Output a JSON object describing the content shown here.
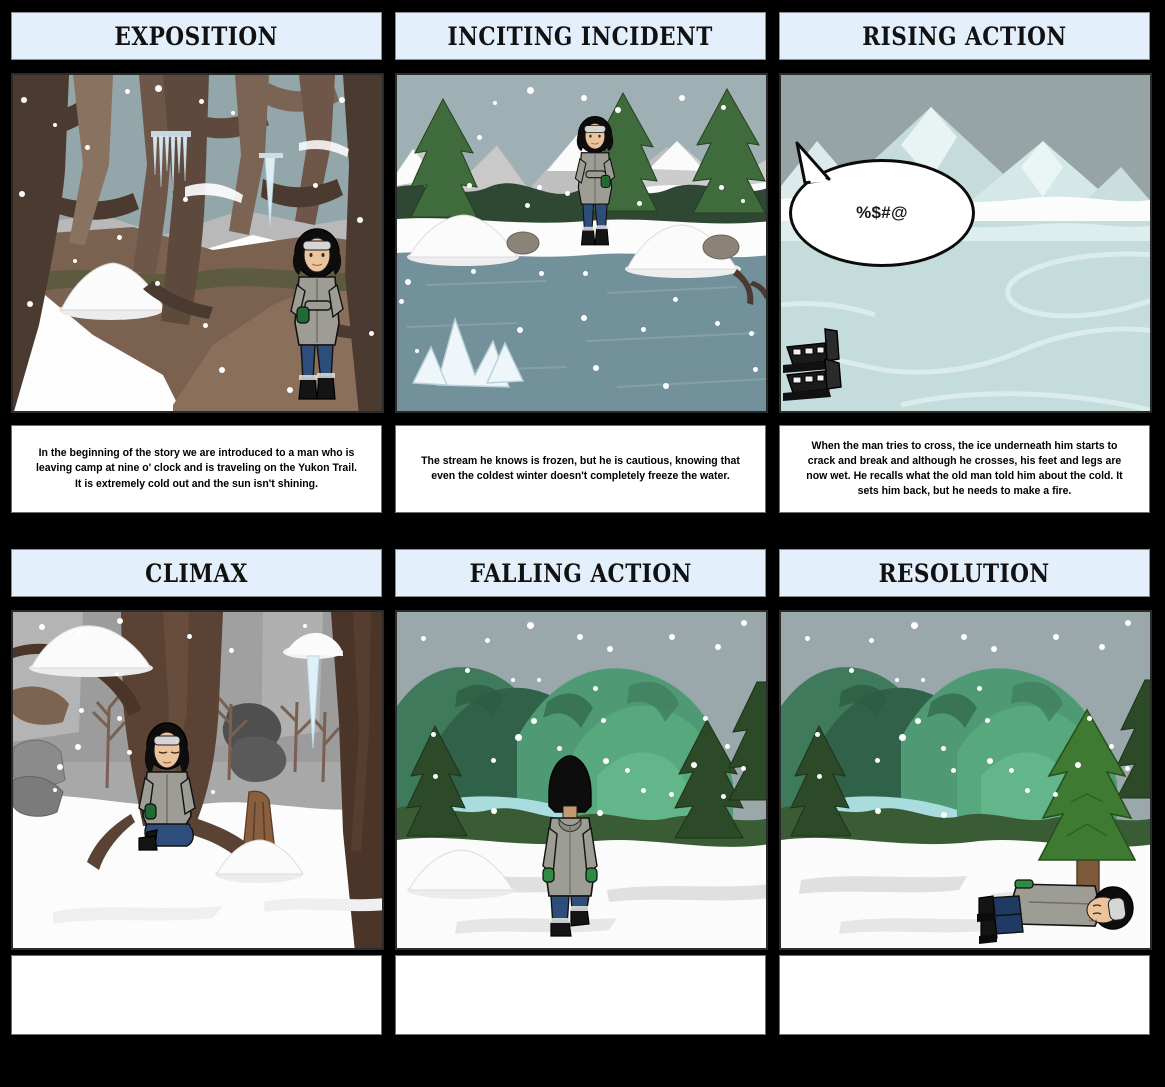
{
  "board": {
    "background_color": "#000000",
    "title_bar_color": "#e3f0fc",
    "caption_background": "#ffffff"
  },
  "panels": [
    {
      "id": "exposition",
      "title": "EXPOSITION",
      "caption": "In the beginning of the story we are introduced to a man who is leaving camp at nine o' clock and is traveling on the Yukon Trail. It is extremely cold out and the sun isn't shining.",
      "scene": "dark-winter-forest-with-icicles-and-standing-man",
      "speech": null
    },
    {
      "id": "inciting-incident",
      "title": "INCITING INCIDENT",
      "caption": "The stream he knows is frozen, but he is cautious, knowing that even the coldest winter doesn't completely freeze the water.",
      "scene": "frozen-stream-with-pines-mountains-and-standing-man",
      "speech": null
    },
    {
      "id": "rising-action",
      "title": "RISING ACTION",
      "caption": "When the man tries to cross, the ice underneath him starts to crack and break and although he crosses, his feet and legs are now wet. He recalls what the old man told him about the cold. It sets him back, but he needs to make a fire.",
      "scene": "pale-icy-river-with-boots-and-speech-bubble",
      "speech": "%$#@"
    },
    {
      "id": "climax",
      "title": "CLIMAX",
      "caption": "",
      "scene": "kneeling-man-beside-large-tree-in-snow",
      "speech": null
    },
    {
      "id": "falling-action",
      "title": "FALLING ACTION",
      "caption": "",
      "scene": "man-walking-away-on-snowy-path-green-hills",
      "speech": null
    },
    {
      "id": "resolution",
      "title": "RESOLUTION",
      "caption": "",
      "scene": "man-lying-in-snow-beside-pine-tree",
      "speech": null
    }
  ],
  "colors": {
    "forest_trunk": "#5d4a3c",
    "snow": "#ffffff",
    "frozen_water": "#73919b",
    "ice_pale": "#c5dcdc",
    "green_hills": "#4f9a74",
    "pine_green": "#39632f",
    "sky_grey": "#9fb0b4",
    "jacket_grey": "#9d9d95",
    "jeans_blue": "#2d4e7a",
    "glove_green": "#1f6b33",
    "boot_black": "#141414"
  }
}
